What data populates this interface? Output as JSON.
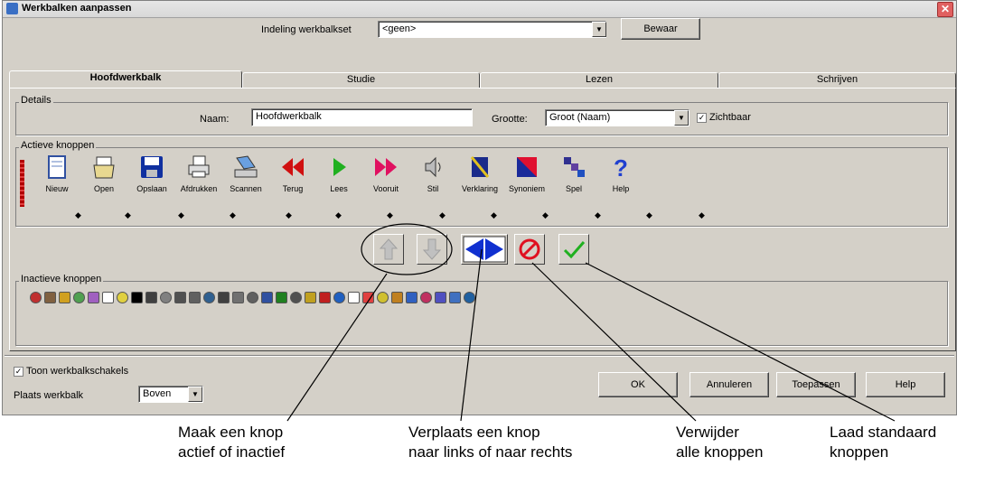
{
  "window": {
    "title": "Werkbalken aanpassen"
  },
  "layout_set": {
    "label": "Indeling werkbalkset",
    "value": "<geen>",
    "save_button": "Bewaar"
  },
  "tabs": [
    "Hoofdwerkbalk",
    "Studie",
    "Lezen",
    "Schrijven"
  ],
  "details": {
    "group_label": "Details",
    "name_label": "Naam:",
    "name_value": "Hoofdwerkbalk",
    "size_label": "Grootte:",
    "size_value": "Groot (Naam)",
    "visible_label": "Zichtbaar",
    "visible_checked": true
  },
  "active_buttons": {
    "group_label": "Actieve knoppen",
    "items": [
      {
        "label": "Nieuw",
        "icon": "new-document-icon"
      },
      {
        "label": "Open",
        "icon": "open-icon"
      },
      {
        "label": "Opslaan",
        "icon": "save-icon"
      },
      {
        "label": "Afdrukken",
        "icon": "print-icon"
      },
      {
        "label": "Scannen",
        "icon": "scan-icon"
      },
      {
        "label": "Terug",
        "icon": "rewind-icon"
      },
      {
        "label": "Lees",
        "icon": "play-icon"
      },
      {
        "label": "Vooruit",
        "icon": "forward-icon"
      },
      {
        "label": "Stil",
        "icon": "speaker-icon"
      },
      {
        "label": "Verklaring",
        "icon": "definition-icon"
      },
      {
        "label": "Synoniem",
        "icon": "synonym-icon"
      },
      {
        "label": "Spel",
        "icon": "spell-icon"
      },
      {
        "label": "Help",
        "icon": "help-icon"
      }
    ]
  },
  "controls": [
    "arrow-up-icon",
    "arrow-down-icon",
    "move-left-right-icon",
    "remove-all-icon",
    "load-default-icon"
  ],
  "inactive_buttons": {
    "group_label": "Inactieve knoppen"
  },
  "bottom": {
    "show_links_label": "Toon werkbalkschakels",
    "show_links_checked": true,
    "position_label": "Plaats werkbalk",
    "position_value": "Boven",
    "ok": "OK",
    "cancel": "Annuleren",
    "apply": "Toepassen",
    "help": "Help"
  },
  "annotations": [
    {
      "line1": "Maak een knop",
      "line2": "actief of inactief"
    },
    {
      "line1": "Verplaats een knop",
      "line2": "naar links of naar rechts"
    },
    {
      "line1": "Verwijder",
      "line2": "alle knoppen"
    },
    {
      "line1": "Laad standaard",
      "line2": "knoppen"
    }
  ]
}
